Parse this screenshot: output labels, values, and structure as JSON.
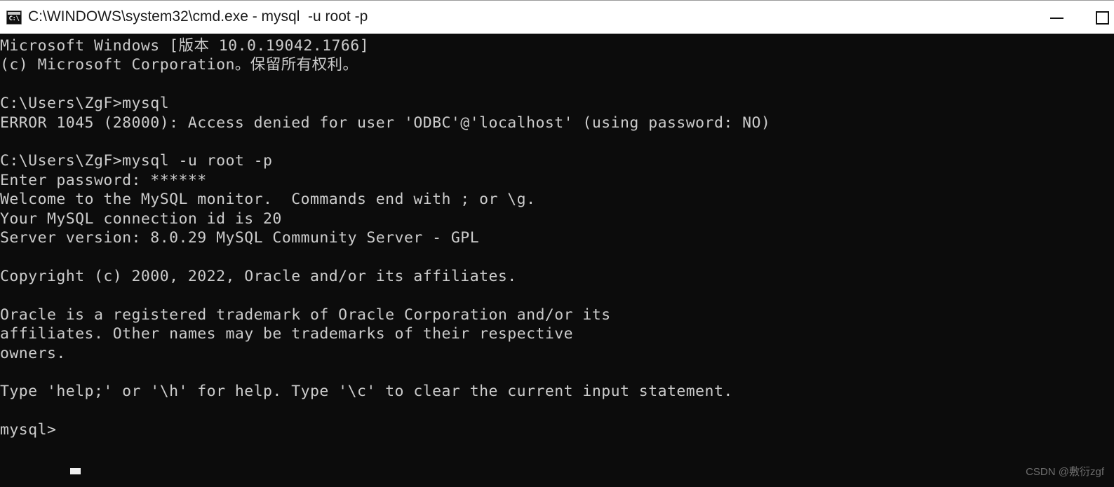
{
  "window": {
    "title": "C:\\WINDOWS\\system32\\cmd.exe - mysql  -u root -p",
    "icon_name": "cmd-console-icon",
    "icon_glyph": "C:\\",
    "titlebar_bg": "#ffffff",
    "titlebar_text_color": "#1b1b1b",
    "controls": {
      "minimize_label": "Minimize",
      "maximize_label": "Maximize"
    }
  },
  "terminal": {
    "background": "#0c0c0c",
    "foreground": "#cccccc",
    "cursor": "block",
    "content": "Microsoft Windows [版本 10.0.19042.1766]\n(c) Microsoft Corporation。保留所有权利。\n\nC:\\Users\\ZgF>mysql\nERROR 1045 (28000): Access denied for user 'ODBC'@'localhost' (using password: NO)\n\nC:\\Users\\ZgF>mysql -u root -p\nEnter password: ******\nWelcome to the MySQL monitor.  Commands end with ; or \\g.\nYour MySQL connection id is 20\nServer version: 8.0.29 MySQL Community Server - GPL\n\nCopyright (c) 2000, 2022, Oracle and/or its affiliates.\n\nOracle is a registered trademark of Oracle Corporation and/or its\naffiliates. Other names may be trademarks of their respective\nowners.\n\nType 'help;' or '\\h' for help. Type '\\c' to clear the current input statement.\n\nmysql>",
    "lines": [
      "Microsoft Windows [版本 10.0.19042.1766]",
      "(c) Microsoft Corporation。保留所有权利。",
      "",
      "C:\\Users\\ZgF>mysql",
      "ERROR 1045 (28000): Access denied for user 'ODBC'@'localhost' (using password: NO)",
      "",
      "C:\\Users\\ZgF>mysql -u root -p",
      "Enter password: ******",
      "Welcome to the MySQL monitor.  Commands end with ; or \\g.",
      "Your MySQL connection id is 20",
      "Server version: 8.0.29 MySQL Community Server - GPL",
      "",
      "Copyright (c) 2000, 2022, Oracle and/or its affiliates.",
      "",
      "Oracle is a registered trademark of Oracle Corporation and/or its",
      "affiliates. Other names may be trademarks of their respective",
      "owners.",
      "",
      "Type 'help;' or '\\h' for help. Type '\\c' to clear the current input statement.",
      "",
      "mysql>"
    ],
    "prompt": "mysql>",
    "connection_id": "20",
    "server_version": "8.0.29 MySQL Community Server - GPL",
    "error_code": "ERROR 1045 (28000)"
  },
  "watermark": {
    "text": "CSDN @敷衍zgf"
  }
}
